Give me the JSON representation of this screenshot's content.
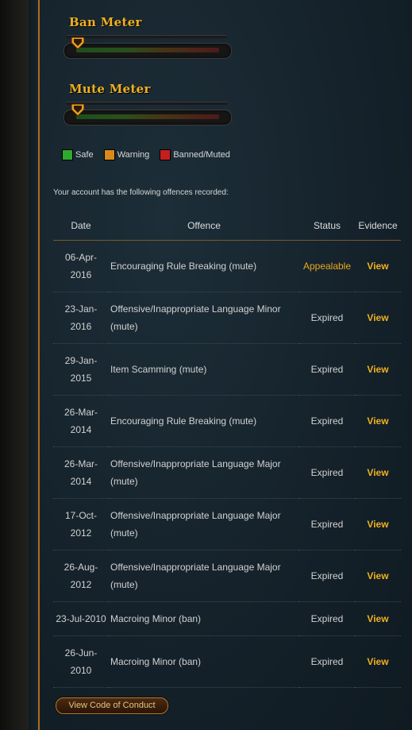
{
  "ban_meter": {
    "title": "Ban Meter",
    "level_percent": 0
  },
  "mute_meter": {
    "title": "Mute Meter",
    "level_percent": 0
  },
  "legend": {
    "items": [
      {
        "label": "Safe",
        "color": "#2fa82f"
      },
      {
        "label": "Warning",
        "color": "#d98a1a"
      },
      {
        "label": "Banned/Muted",
        "color": "#c41f1f"
      }
    ]
  },
  "intro_text": "Your account has the following offences recorded:",
  "table": {
    "headers": {
      "date": "Date",
      "offence": "Offence",
      "status": "Status",
      "evidence": "Evidence"
    },
    "rows": [
      {
        "date": "06-Apr-2016",
        "offence": "Encouraging Rule Breaking (mute)",
        "status": "Appealable",
        "evidence": "View"
      },
      {
        "date": "23-Jan-2016",
        "offence": "Offensive/Inappropriate Language Minor (mute)",
        "status": "Expired",
        "evidence": "View"
      },
      {
        "date": "29-Jan-2015",
        "offence": "Item Scamming (mute)",
        "status": "Expired",
        "evidence": "View"
      },
      {
        "date": "26-Mar-2014",
        "offence": "Encouraging Rule Breaking (mute)",
        "status": "Expired",
        "evidence": "View"
      },
      {
        "date": "26-Mar-2014",
        "offence": "Offensive/Inappropriate Language Major (mute)",
        "status": "Expired",
        "evidence": "View"
      },
      {
        "date": "17-Oct-2012",
        "offence": "Offensive/Inappropriate Language Major (mute)",
        "status": "Expired",
        "evidence": "View"
      },
      {
        "date": "26-Aug-2012",
        "offence": "Offensive/Inappropriate Language Major (mute)",
        "status": "Expired",
        "evidence": "View"
      },
      {
        "date": "23-Jul-2010",
        "offence": "Macroing Minor (ban)",
        "status": "Expired",
        "evidence": "View"
      },
      {
        "date": "26-Jun-2010",
        "offence": "Macroing Minor (ban)",
        "status": "Expired",
        "evidence": "View"
      }
    ]
  },
  "code_of_conduct_button": "View Code of Conduct"
}
